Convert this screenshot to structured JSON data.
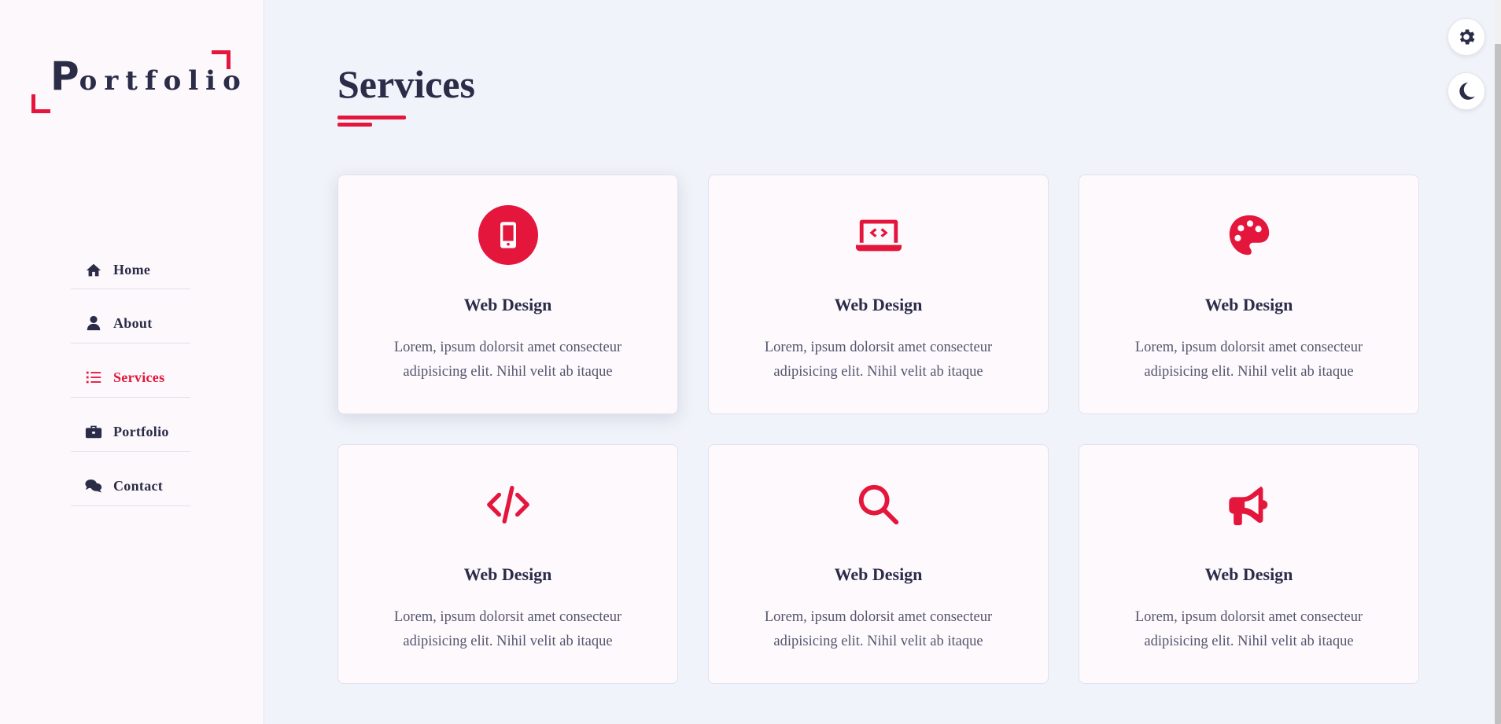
{
  "brand": {
    "logo_first_letter": "P",
    "logo_rest": "ortfolio",
    "accent_color": "#e4163c",
    "text_color": "#2b2c48"
  },
  "sidebar": {
    "items": [
      {
        "label": "Home",
        "icon": "home-icon",
        "active": false
      },
      {
        "label": "About",
        "icon": "user-icon",
        "active": false
      },
      {
        "label": "Services",
        "icon": "list-icon",
        "active": true
      },
      {
        "label": "Portfolio",
        "icon": "briefcase-icon",
        "active": false
      },
      {
        "label": "Contact",
        "icon": "comments-icon",
        "active": false
      }
    ]
  },
  "main": {
    "title": "Services",
    "cards": [
      {
        "icon": "mobile-icon",
        "title": "Web Design",
        "text": "Lorem, ipsum dolorsit amet consecteur adipisicing elit. Nihil velit ab itaque"
      },
      {
        "icon": "laptop-code-icon",
        "title": "Web Design",
        "text": "Lorem, ipsum dolorsit amet consecteur adipisicing elit. Nihil velit ab itaque"
      },
      {
        "icon": "palette-icon",
        "title": "Web Design",
        "text": "Lorem, ipsum dolorsit amet consecteur adipisicing elit. Nihil velit ab itaque"
      },
      {
        "icon": "code-icon",
        "title": "Web Design",
        "text": "Lorem, ipsum dolorsit amet consecteur adipisicing elit. Nihil velit ab itaque"
      },
      {
        "icon": "search-icon",
        "title": "Web Design",
        "text": "Lorem, ipsum dolorsit amet consecteur adipisicing elit. Nihil velit ab itaque"
      },
      {
        "icon": "megaphone-icon",
        "title": "Web Design",
        "text": "Lorem, ipsum dolorsit amet consecteur adipisicing elit. Nihil velit ab itaque"
      }
    ]
  },
  "floating_buttons": {
    "settings_icon": "gear-icon",
    "theme_icon": "moon-icon"
  }
}
